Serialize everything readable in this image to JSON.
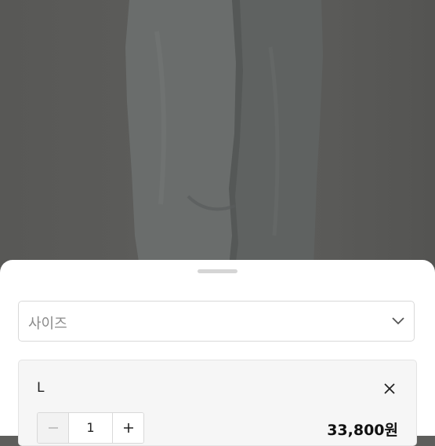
{
  "product_image": {
    "alt": ""
  },
  "size_select": {
    "placeholder": "사이즈",
    "icon": "chevron-down-icon"
  },
  "selected_option": {
    "name": "L",
    "quantity": "1",
    "price": "33,800원",
    "remove_icon": "close-icon",
    "decrease_icon": "minus-icon",
    "increase_icon": "plus-icon"
  },
  "colors": {
    "sheet_bg": "#ffffff",
    "option_bg": "#f6f6f6",
    "photo_bg": "#5e5e5c"
  }
}
